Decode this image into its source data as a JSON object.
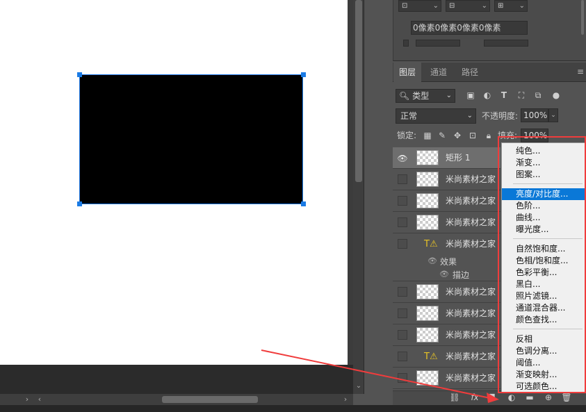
{
  "properties": {
    "padding_value": "0像素0像素0像素0像素"
  },
  "tabs": [
    {
      "label": "图层",
      "active": true
    },
    {
      "label": "通道",
      "active": false
    },
    {
      "label": "路径",
      "active": false
    }
  ],
  "filter": {
    "label": "类型"
  },
  "blend": {
    "mode": "正常",
    "opacity_label": "不透明度:",
    "opacity_value": "100%"
  },
  "lock": {
    "label": "锁定:",
    "fill_label": "填充:",
    "fill_value": "100%"
  },
  "layers": [
    {
      "name": "矩形 1",
      "selected": true,
      "visible": true
    },
    {
      "name": "米尚素材之家"
    },
    {
      "name": "米尚素材之家"
    },
    {
      "name": "米尚素材之家"
    },
    {
      "name": "米尚素材之家",
      "type": "text-warning"
    },
    {
      "name": "米尚素材之家"
    },
    {
      "name": "米尚素材之家"
    },
    {
      "name": "米尚素材之家"
    },
    {
      "name": "米尚素材之家",
      "type": "text-warning"
    },
    {
      "name": "米尚素材之家"
    }
  ],
  "effects": {
    "label": "效果",
    "stroke": "描边"
  },
  "adjustment_menu": {
    "group1": [
      "纯色...",
      "渐变...",
      "图案..."
    ],
    "group2": [
      "亮度/对比度...",
      "色阶...",
      "曲线...",
      "曝光度..."
    ],
    "group3": [
      "自然饱和度...",
      "色相/饱和度...",
      "色彩平衡...",
      "黑白...",
      "照片滤镜...",
      "通道混合器...",
      "颜色查找..."
    ],
    "group4": [
      "反相",
      "色调分离...",
      "阈值...",
      "渐变映射...",
      "可选颜色..."
    ],
    "highlighted": "亮度/对比度..."
  },
  "colors": {
    "highlight": "#0a78d7",
    "annotation": "#f03c3c",
    "selection": "#1a7be5"
  }
}
